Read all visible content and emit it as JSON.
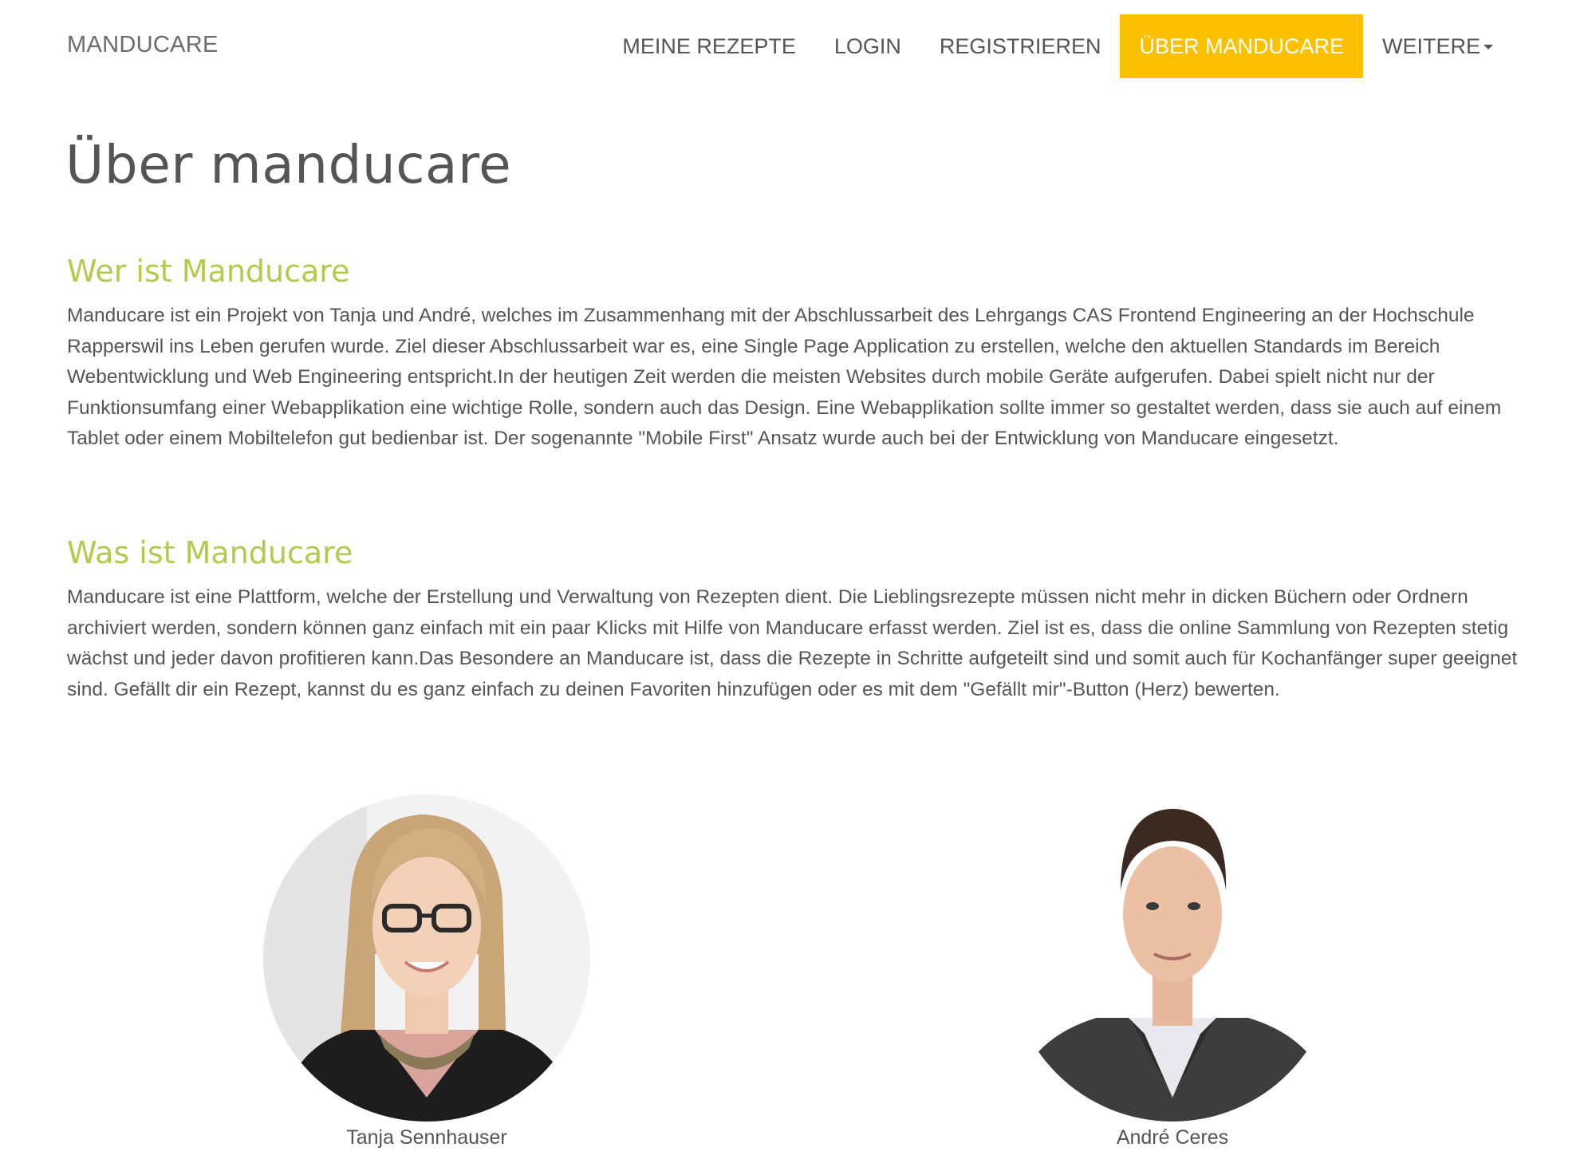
{
  "navbar": {
    "brand": "MANDUCARE",
    "items": [
      {
        "label": "MEINE REZEPTE",
        "active": false
      },
      {
        "label": "LOGIN",
        "active": false
      },
      {
        "label": "REGISTRIEREN",
        "active": false
      },
      {
        "label": "ÜBER MANDUCARE",
        "active": true
      },
      {
        "label": "WEITERE",
        "active": false,
        "dropdown": true
      }
    ],
    "active_color": "#fbc101"
  },
  "page": {
    "title": "Über manducare"
  },
  "sections": [
    {
      "heading": "Wer ist Manducare",
      "text": "Manducare ist ein Projekt von Tanja und André, welches im Zusammenhang mit der Abschlussarbeit des Lehrgangs CAS Frontend Engineering an der Hochschule Rapperswil ins Leben gerufen wurde. Ziel dieser Abschlussarbeit war es, eine Single Page Application zu erstellen, welche den aktuellen Standards im Bereich Webentwicklung und Web Engineering entspricht.In der heutigen Zeit werden die meisten Websites durch mobile Geräte aufgerufen. Dabei spielt nicht nur der Funktionsumfang einer Webapplikation eine wichtige Rolle, sondern auch das Design. Eine Webapplikation sollte immer so gestaltet werden, dass sie auch auf einem Tablet oder einem Mobiltelefon gut bedienbar ist. Der sogenannte \"Mobile First\" Ansatz wurde auch bei der Entwicklung von Manducare eingesetzt."
    },
    {
      "heading": "Was ist Manducare",
      "text": "Manducare ist eine Plattform, welche der Erstellung und Verwaltung von Rezepten dient. Die Lieblingsrezepte müssen nicht mehr in dicken Büchern oder Ordnern archiviert werden, sondern können ganz einfach mit ein paar Klicks mit Hilfe von Manducare erfasst werden. Ziel ist es, dass die online Sammlung von Rezepten stetig wächst und jeder davon profitieren kann.Das Besondere an Manducare ist, dass die Rezepte in Schritte aufgeteilt sind und somit auch für Kochanfänger super geeignet sind. Gefällt dir ein Rezept, kannst du es ganz einfach zu deinen Favoriten hinzufügen oder es mit dem \"Gefällt mir\"-Button (Herz) bewerten."
    }
  ],
  "team": [
    {
      "name": "Tanja Sennhauser",
      "photo": "portrait-woman-blonde-glasses"
    },
    {
      "name": "André Ceres",
      "photo": "portrait-man-dark-hair-suit"
    }
  ],
  "colors": {
    "heading_accent": "#b5c94b",
    "text": "#555555"
  }
}
